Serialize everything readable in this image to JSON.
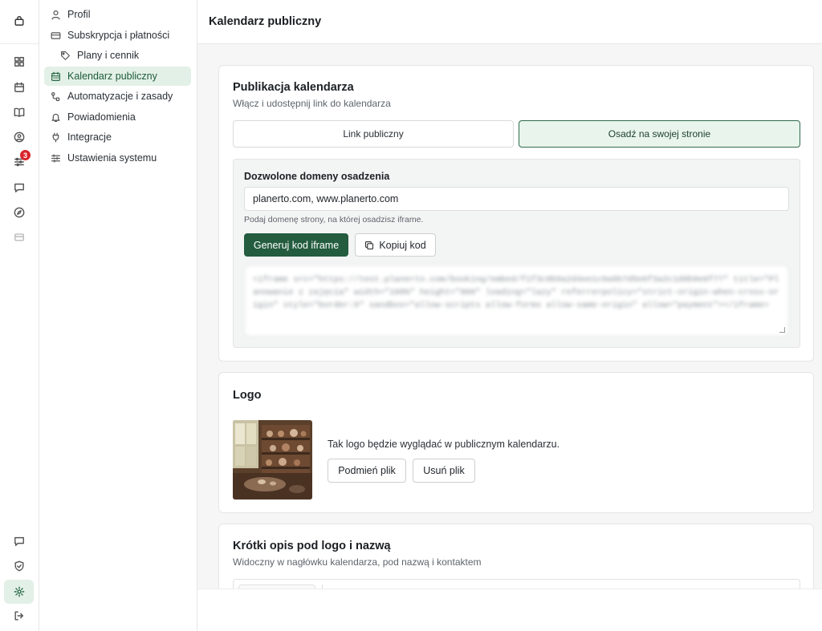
{
  "rail": {
    "icons": [
      "bag-icon",
      "grid-icon",
      "calendar-icon",
      "book-icon",
      "user-circle-icon",
      "sliders-icon",
      "message-icon",
      "compass-icon",
      "card-icon"
    ],
    "badge_count": "3",
    "bottom_icons": [
      "chat-icon",
      "shield-icon",
      "gear-icon",
      "logout-icon"
    ]
  },
  "nav": {
    "items": [
      {
        "label": "Profil",
        "icon": "user-icon"
      },
      {
        "label": "Subskrypcja i płatności",
        "icon": "card-icon"
      },
      {
        "label": "Plany i cennik",
        "icon": "tag-icon"
      },
      {
        "label": "Kalendarz publiczny",
        "icon": "calendar-icon"
      },
      {
        "label": "Automatyzacje i zasady",
        "icon": "workflow-icon"
      },
      {
        "label": "Powiadomienia",
        "icon": "bell-icon"
      },
      {
        "label": "Integracje",
        "icon": "plug-icon"
      },
      {
        "label": "Ustawienia systemu",
        "icon": "sliders-icon"
      }
    ]
  },
  "header": {
    "title": "Kalendarz publiczny"
  },
  "publish": {
    "title": "Publikacja kalendarza",
    "subtitle": "Włącz i udostępnij link do kalendarza",
    "tab_link": "Link publiczny",
    "tab_embed": "Osadź na swojej stronie",
    "domains_label": "Dozwolone domeny osadzenia",
    "domains_value": "planerto.com, www.planerto.com",
    "domains_hint": "Podaj domenę strony, na której osadzisz iframe.",
    "generate_label": "Generuj kod iframe",
    "copy_label": "Kopiuj kod",
    "code": "<iframe src=\"https://test.planerto.com/booking/embed/f1f3c8b9a2d4ee1c9a0b7d5e6f3a2c1d0b9e8f7?\" title=\"Planowanie z zajęcia\" width=\"100%\" height=\"800\" loading=\"lazy\" referrerpolicy=\"strict-origin-when-cross-origin\" style=\"border:0\" sandbox=\"allow-scripts allow-forms allow-same-origin\" allow=\"payment\"></iframe>"
  },
  "logo": {
    "title": "Logo",
    "description": "Tak logo będzie wyglądać w publicznym kalendarzu.",
    "replace_label": "Podmień plik",
    "remove_label": "Usuń plik"
  },
  "short_desc": {
    "title": "Krótki opis pod logo i nazwą",
    "subtitle": "Widoczny w nagłówku kalendarza, pod nazwą i kontaktem"
  }
}
